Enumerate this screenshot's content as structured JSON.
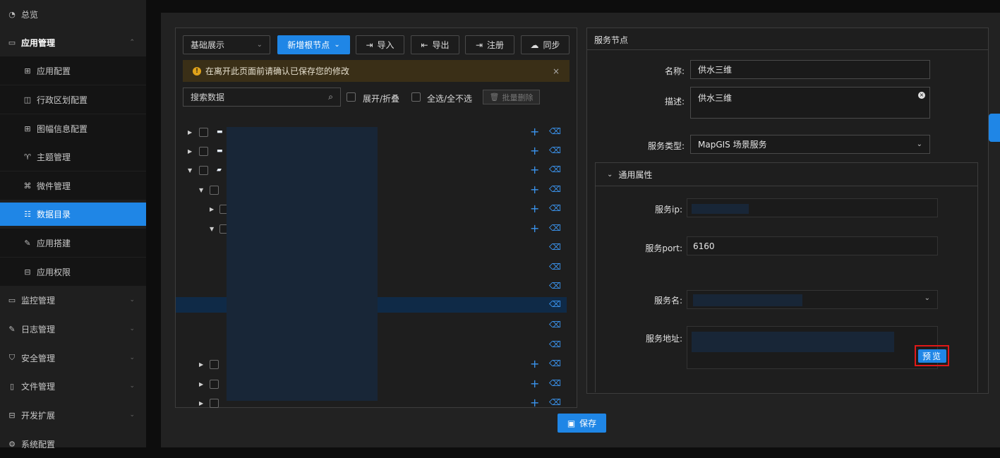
{
  "sidebar": {
    "items": [
      {
        "label": "总览",
        "icon": "dashboard-icon"
      },
      {
        "label": "应用管理",
        "icon": "monitor-icon"
      },
      {
        "label": "应用配置",
        "icon": "config-icon"
      },
      {
        "label": "行政区划配置",
        "icon": "map-region-icon"
      },
      {
        "label": "图幅信息配置",
        "icon": "grid-icon"
      },
      {
        "label": "主题管理",
        "icon": "shirt-icon"
      },
      {
        "label": "微件管理",
        "icon": "puzzle-icon"
      },
      {
        "label": "数据目录",
        "icon": "catalog-icon"
      },
      {
        "label": "应用搭建",
        "icon": "edit-icon"
      },
      {
        "label": "应用权限",
        "icon": "lock-icon"
      },
      {
        "label": "监控管理",
        "icon": "monitor-icon"
      },
      {
        "label": "日志管理",
        "icon": "log-icon"
      },
      {
        "label": "安全管理",
        "icon": "shield-icon"
      },
      {
        "label": "文件管理",
        "icon": "file-icon"
      },
      {
        "label": "开发扩展",
        "icon": "extension-icon"
      },
      {
        "label": "系统配置",
        "icon": "gear-icon"
      }
    ]
  },
  "toolbar": {
    "view_select": "基础展示",
    "new_root": "新增根节点",
    "import": "导入",
    "export": "导出",
    "register": "注册",
    "sync": "同步"
  },
  "warning": "在离开此页面前请确认已保存您的修改",
  "search": {
    "placeholder": "搜索数据"
  },
  "tree_controls": {
    "expand": "展开/折叠",
    "select_all": "全选/全不选",
    "batch_delete": "批量删除"
  },
  "form": {
    "section_title": "服务节点",
    "name_label": "名称:",
    "name_value": "供水三维",
    "desc_label": "描述:",
    "desc_value": "供水三维",
    "type_label": "服务类型:",
    "type_value": "MapGIS 场景服务",
    "common_title": "通用属性",
    "ip_label": "服务ip:",
    "port_label": "服务port:",
    "port_value": "6160",
    "svc_name_label": "服务名:",
    "svc_addr_label": "服务地址:",
    "preview": "预览"
  },
  "save": "保存",
  "colors": {
    "accent": "#1f86e6",
    "highlight": "#e01818",
    "warning_bg": "#3a2f17"
  }
}
